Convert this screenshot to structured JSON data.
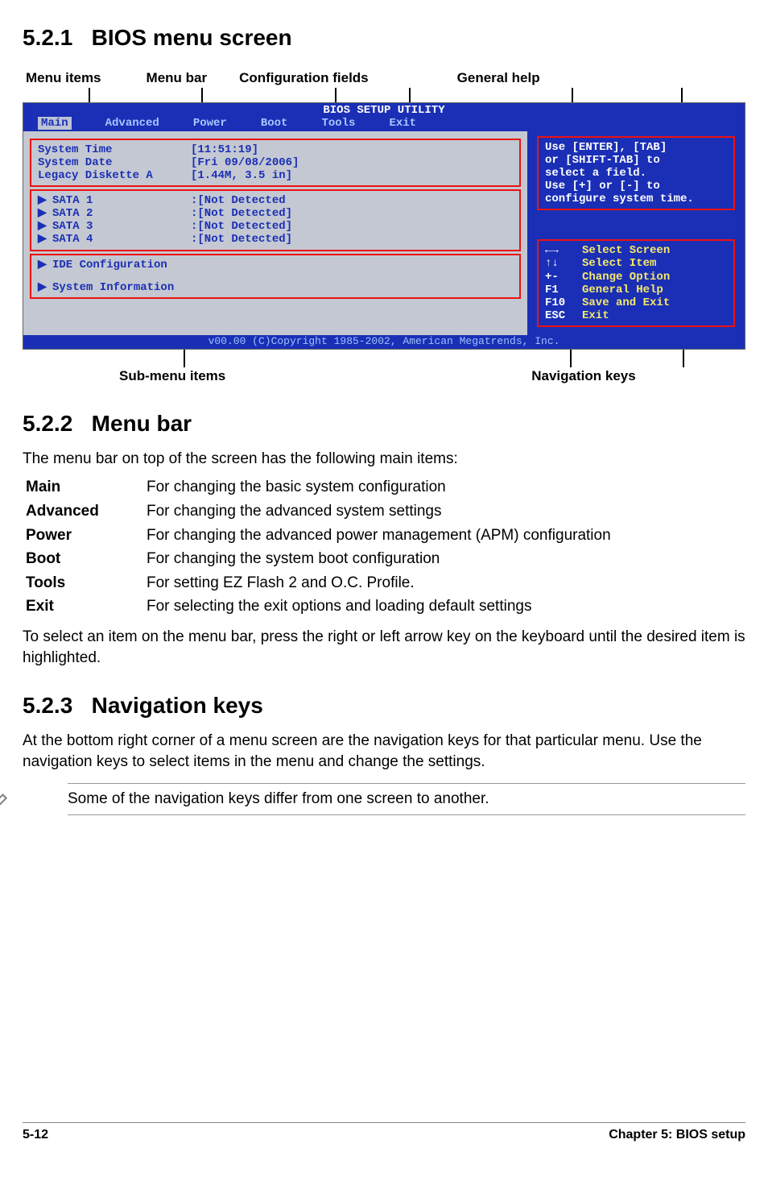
{
  "sections": {
    "s1_num": "5.2.1",
    "s1_title": "BIOS menu screen",
    "s2_num": "5.2.2",
    "s2_title": "Menu bar",
    "s3_num": "5.2.3",
    "s3_title": "Navigation keys"
  },
  "top_labels": {
    "items": "Menu items",
    "bar": "Menu bar",
    "conf": "Configuration fields",
    "help": "General help"
  },
  "bottom_labels": {
    "sub": "Sub-menu items",
    "nav": "Navigation keys"
  },
  "bios": {
    "title": "BIOS SETUP UTILITY",
    "menubar": [
      "Main",
      "Advanced",
      "Power",
      "Boot",
      "Tools",
      "Exit"
    ],
    "menubar_selected": 0,
    "left_top": [
      {
        "k": "System Time",
        "v": "[11:51:19]"
      },
      {
        "k": "System Date",
        "v": "[Fri 09/08/2006]"
      },
      {
        "k": "Legacy Diskette A",
        "v": "[1.44M, 3.5 in]"
      }
    ],
    "sata": [
      {
        "k": "SATA 1",
        "v": ":[Not Detected"
      },
      {
        "k": "SATA 2",
        "v": ":[Not Detected]"
      },
      {
        "k": "SATA 3",
        "v": ":[Not Detected]"
      },
      {
        "k": "SATA 4",
        "v": ":[Not Detected]"
      }
    ],
    "left_bottom": [
      "IDE Configuration",
      "System Information"
    ],
    "help_lines": [
      "Use [ENTER], [TAB]",
      "or [SHIFT-TAB] to",
      "select a field.",
      "Use [+] or [-] to",
      "configure system time."
    ],
    "nav_keys": [
      {
        "key": "←→",
        "label": "Select Screen"
      },
      {
        "key": "↑↓",
        "label": "Select Item"
      },
      {
        "key": "+-",
        "label": "Change Option"
      },
      {
        "key": "F1",
        "label": "General Help"
      },
      {
        "key": "F10",
        "label": "Save and Exit"
      },
      {
        "key": "ESC",
        "label": "Exit"
      }
    ],
    "footer": "v00.00 (C)Copyright 1985-2002, American Megatrends, Inc."
  },
  "menubar_text": "The menu bar on top of the screen has the following main items:",
  "defs": [
    {
      "term": "Main",
      "desc": "For changing the basic system configuration"
    },
    {
      "term": "Advanced",
      "desc": "For changing the advanced system settings"
    },
    {
      "term": "Power",
      "desc": "For changing the advanced power management (APM) configuration"
    },
    {
      "term": "Boot",
      "desc": "For changing the system boot configuration"
    },
    {
      "term": "Tools",
      "desc": "For setting EZ Flash 2 and O.C. Profile."
    },
    {
      "term": "Exit",
      "desc": "For selecting the exit options and loading default settings"
    }
  ],
  "menubar_tail": "To select an item on the menu bar, press the right or left arrow key on the keyboard until the desired item is highlighted.",
  "nav_text": "At the bottom right corner of a menu screen are the navigation keys for that particular menu. Use the navigation keys to select items in the menu and change the settings.",
  "note": "Some of the navigation keys differ from one screen to another.",
  "footer": {
    "left": "5-12",
    "right": "Chapter 5: BIOS setup"
  }
}
